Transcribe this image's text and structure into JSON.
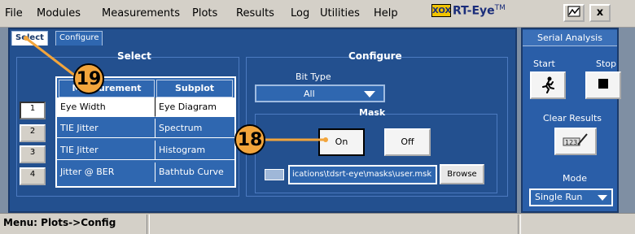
{
  "menu": {
    "items": [
      "File",
      "Modules",
      "Measurements",
      "Plots",
      "Results",
      "Log",
      "Utilities",
      "Help"
    ],
    "logo_text": "XOX",
    "product": "RT-Eye",
    "product_tm": "TM",
    "close_label": "x"
  },
  "tabs": {
    "select": "Select",
    "configure": "Configure"
  },
  "select_group": {
    "title": "Select",
    "headers": {
      "measurement": "Measurement",
      "subplot": "Subplot"
    },
    "rows": [
      {
        "num": "1",
        "measurement": "Eye Width",
        "subplot": "Eye Diagram",
        "selected": true
      },
      {
        "num": "2",
        "measurement": "TIE Jitter",
        "subplot": "Spectrum",
        "selected": false
      },
      {
        "num": "3",
        "measurement": "TIE Jitter",
        "subplot": "Histogram",
        "selected": false
      },
      {
        "num": "4",
        "measurement": "Jitter @ BER",
        "subplot": "Bathtub Curve",
        "selected": false
      }
    ]
  },
  "configure_group": {
    "title": "Configure",
    "bit_type_label": "Bit Type",
    "bit_type_value": "All",
    "mask_title": "Mask",
    "on_label": "On",
    "off_label": "Off",
    "mask_path": "ications\\tdsrt-eye\\masks\\user.msk",
    "browse_label": "Browse"
  },
  "right_panel": {
    "header": "Serial Analysis",
    "start_label": "Start",
    "stop_label": "Stop",
    "clear_label": "Clear Results",
    "mode_label": "Mode",
    "mode_value": "Single Run"
  },
  "status": {
    "text": "Menu: Plots->Config"
  },
  "callouts": {
    "a": "19",
    "b": "18"
  },
  "colors": {
    "panel": "#23508f",
    "callout": "#f2a53c",
    "accent": "#2f67b0"
  }
}
